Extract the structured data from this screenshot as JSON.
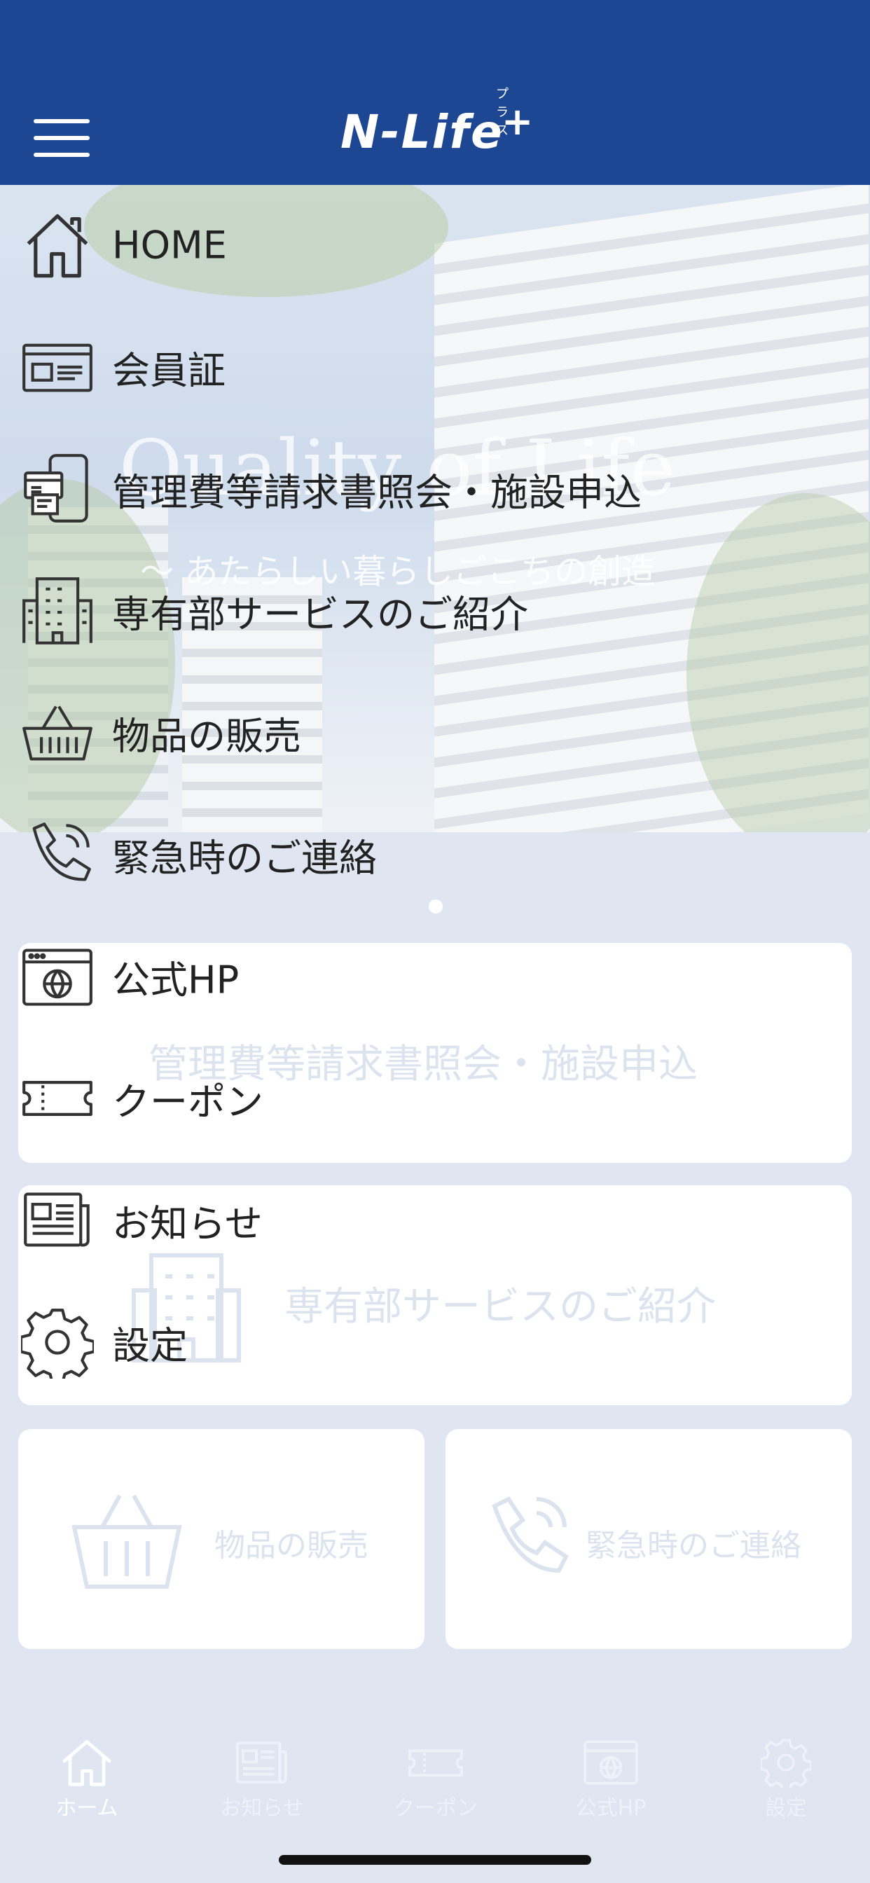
{
  "header": {
    "logo_text": "N-Life",
    "logo_plus": "+",
    "logo_ruby": "プラス"
  },
  "hero": {
    "title": "Quality of Life",
    "subtitle": "～ あたらしい暮らしごこちの創造"
  },
  "menu": {
    "items": [
      {
        "label": "HOME",
        "icon": "home-icon"
      },
      {
        "label": "会員証",
        "icon": "member-card-icon"
      },
      {
        "label": "管理費等請求書照会・施設申込",
        "icon": "invoice-icon"
      },
      {
        "label": "専有部サービスのご紹介",
        "icon": "building-icon"
      },
      {
        "label": "物品の販売",
        "icon": "basket-icon"
      },
      {
        "label": "緊急時のご連絡",
        "icon": "phone-icon"
      },
      {
        "label": "公式HP",
        "icon": "website-icon"
      },
      {
        "label": "クーポン",
        "icon": "coupon-icon"
      },
      {
        "label": "お知らせ",
        "icon": "news-icon"
      },
      {
        "label": "設定",
        "icon": "gear-icon"
      }
    ]
  },
  "cards": {
    "invoice": "管理費等請求書照会・施設申込",
    "service": "専有部サービスのご紹介",
    "goods": "物品の販売",
    "emergency": "緊急時のご連絡"
  },
  "tabbar": {
    "tabs": [
      {
        "label": "ホーム",
        "icon": "home-icon",
        "active": true
      },
      {
        "label": "お知らせ",
        "icon": "news-icon",
        "active": false
      },
      {
        "label": "クーポン",
        "icon": "coupon-icon",
        "active": false
      },
      {
        "label": "公式HP",
        "icon": "website-icon",
        "active": false
      },
      {
        "label": "設定",
        "icon": "gear-icon",
        "active": false
      }
    ]
  },
  "colors": {
    "header": "#1d4793",
    "background": "#dfe6f1",
    "menu_text": "#222222",
    "faint_text": "#dbe3ee"
  }
}
